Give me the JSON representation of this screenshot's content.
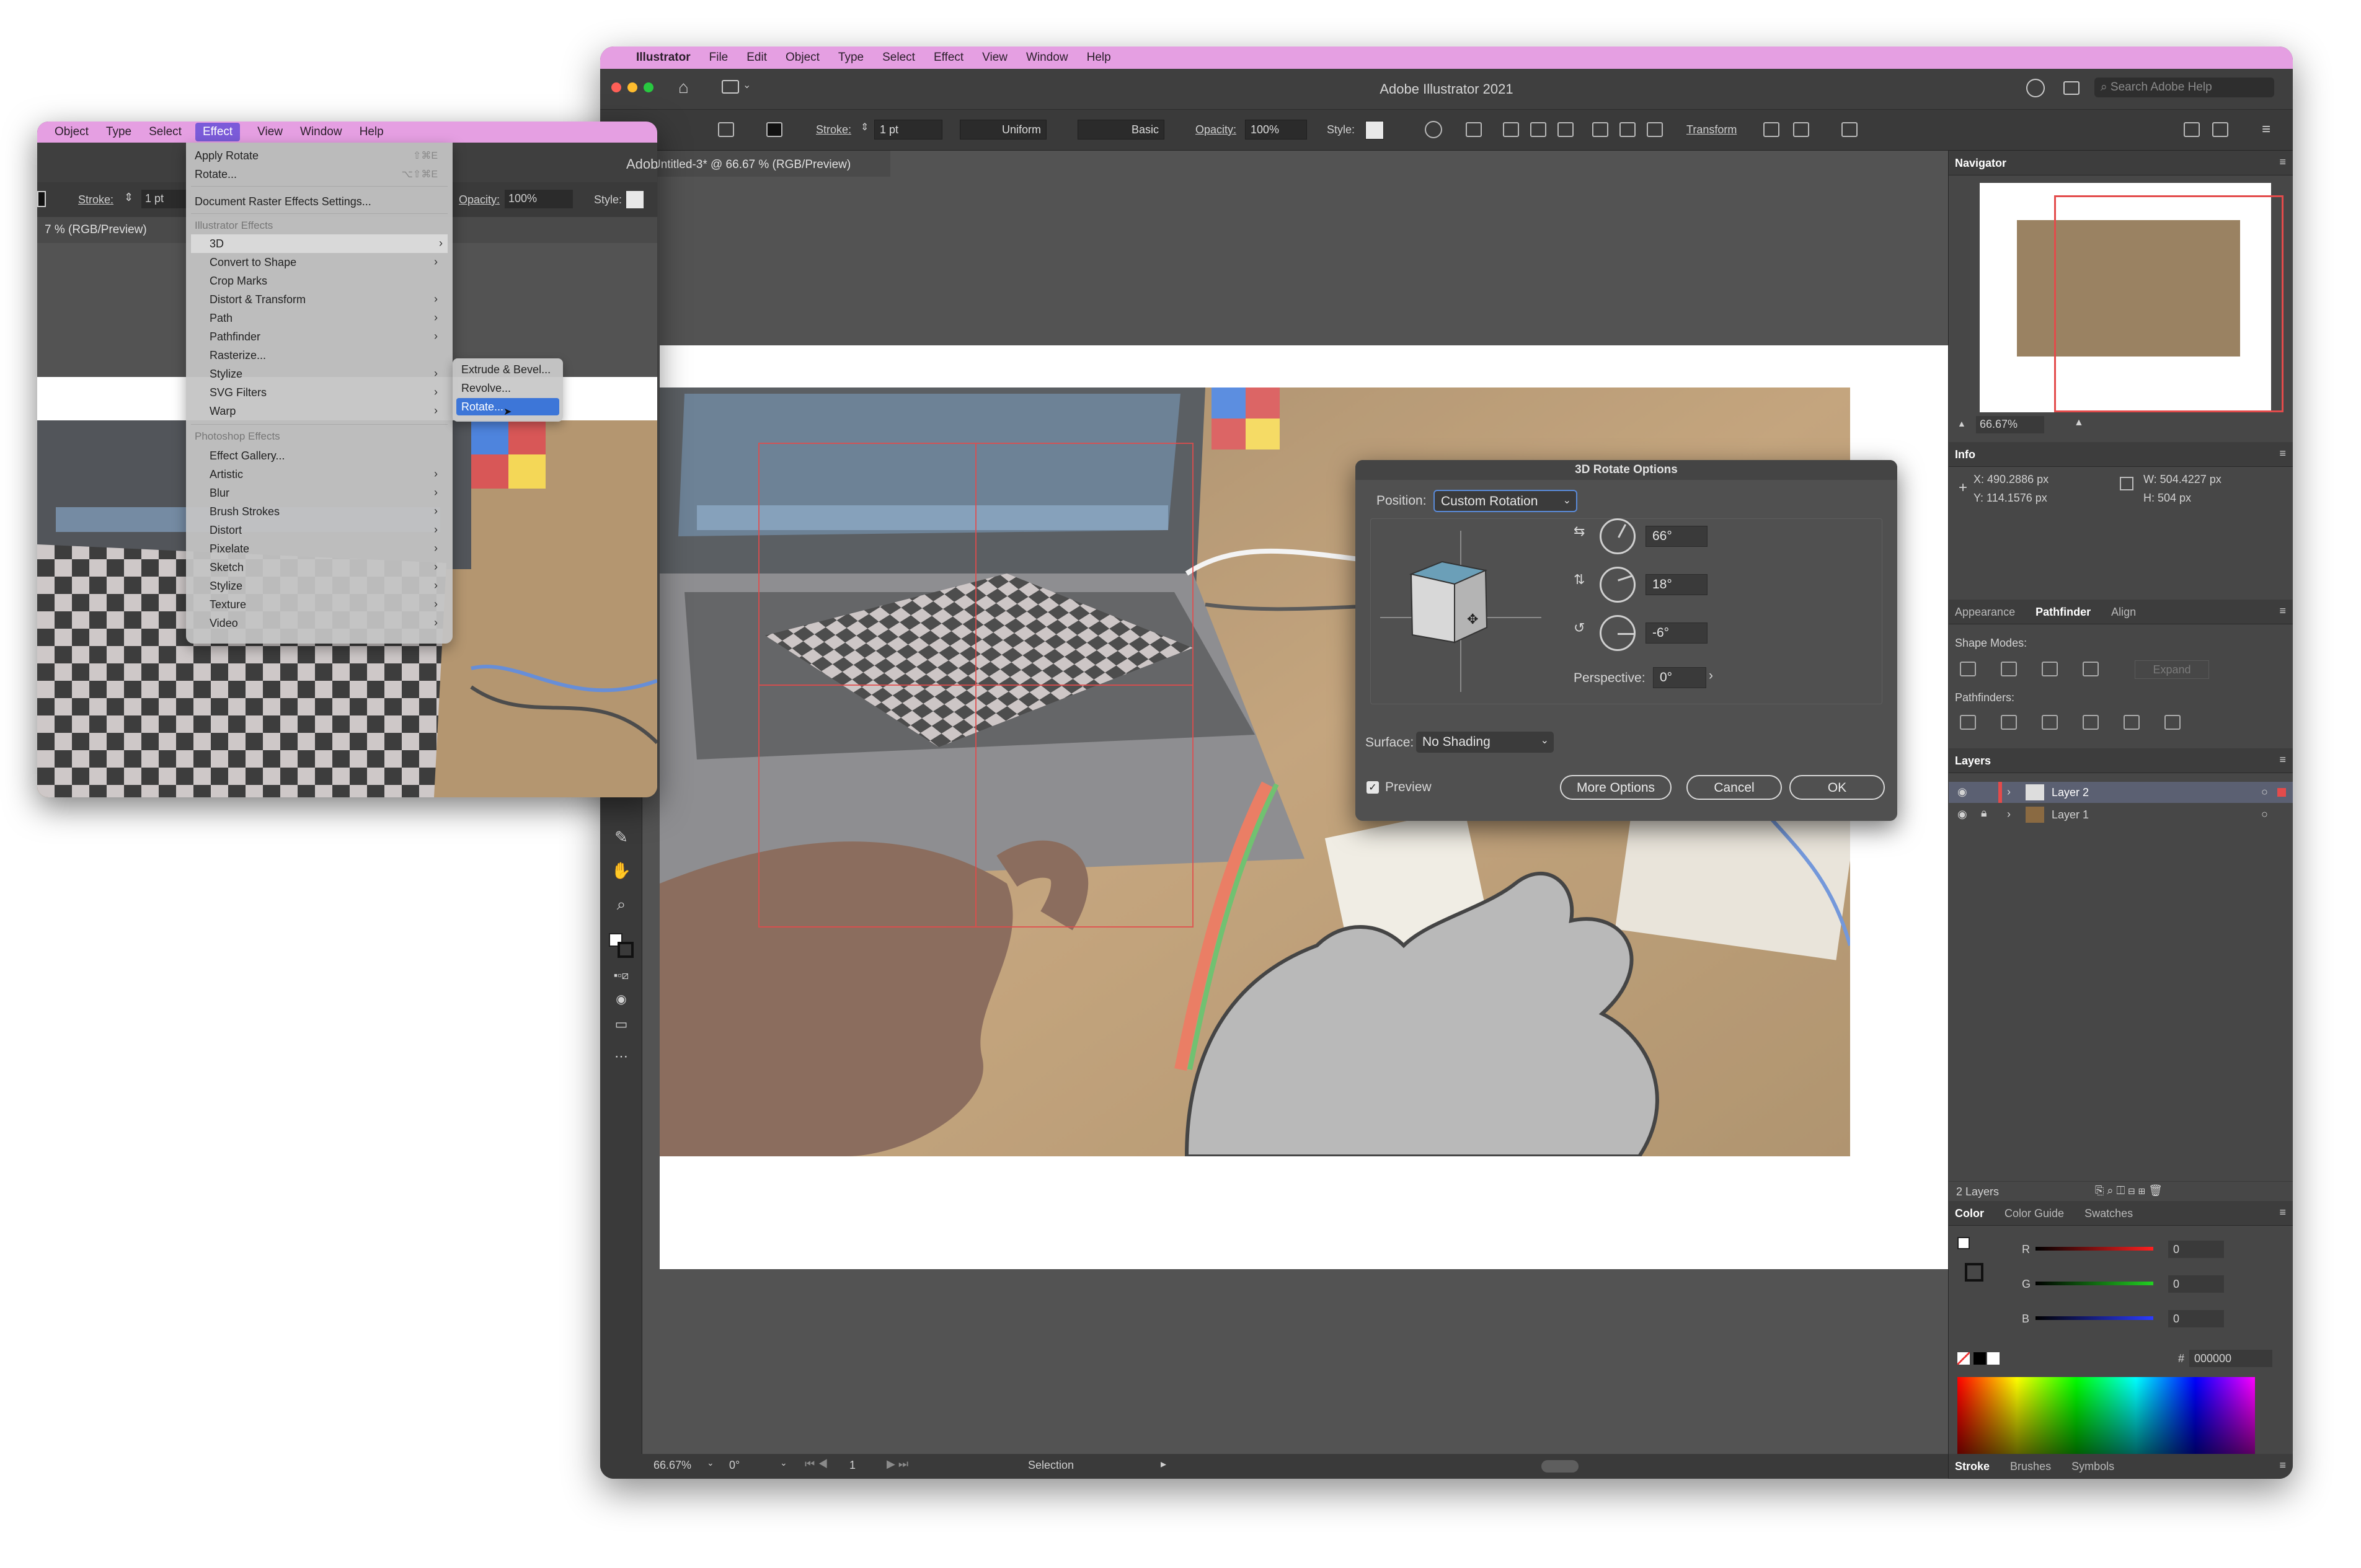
{
  "main": {
    "menubar": {
      "app_name": "Illustrator",
      "items": [
        "File",
        "Edit",
        "Object",
        "Type",
        "Select",
        "Effect",
        "View",
        "Window",
        "Help"
      ]
    },
    "window_title": "Adobe Illustrator 2021",
    "search_placeholder": "Search Adobe Help",
    "control_bar": {
      "stroke_label": "Stroke:",
      "stroke_value": "1 pt",
      "profile_value": "Uniform",
      "brush_value": "Basic",
      "opacity_label": "Opacity:",
      "opacity_value": "100%",
      "style_label": "Style:",
      "transform_label": "Transform"
    },
    "document_tab": "Untitled-3* @ 66.67 % (RGB/Preview)",
    "status_bar": {
      "zoom": "66.67%",
      "rotation": "0°",
      "artboard_number": "1",
      "tool_name": "Selection"
    }
  },
  "panels": {
    "navigator": {
      "title": "Navigator",
      "zoom": "66.67%"
    },
    "info": {
      "title": "Info",
      "x": "X: 490.2886 px",
      "y": "Y: 114.1576 px",
      "w": "W: 504.4227 px",
      "h": "H: 504 px"
    },
    "pathfinder_tabs": [
      "Appearance",
      "Pathfinder",
      "Align"
    ],
    "shape_modes_label": "Shape Modes:",
    "expand_label": "Expand",
    "pathfinders_label": "Pathfinders:",
    "layers": {
      "title": "Layers",
      "items": [
        {
          "name": "Layer 2",
          "color": "#e34b4b"
        },
        {
          "name": "Layer 1",
          "color": "#4b6be3"
        }
      ],
      "count": "2 Layers"
    },
    "color_tabs": [
      "Color",
      "Color Guide",
      "Swatches"
    ],
    "color": {
      "r_label": "R",
      "r_value": "0",
      "g_label": "G",
      "g_value": "0",
      "b_label": "B",
      "b_value": "0",
      "hex_label": "#",
      "hex_value": "000000"
    },
    "bottom_tabs": [
      "Stroke",
      "Brushes",
      "Symbols"
    ]
  },
  "dialog": {
    "title": "3D Rotate Options",
    "position_label": "Position:",
    "position_value": "Custom Rotation",
    "x_angle": "66°",
    "y_angle": "18°",
    "z_angle": "-6°",
    "perspective_label": "Perspective:",
    "perspective_value": "0°",
    "surface_label": "Surface:",
    "surface_value": "No Shading",
    "preview_label": "Preview",
    "more_options": "More Options",
    "cancel": "Cancel",
    "ok": "OK"
  },
  "inset": {
    "menubar": [
      "Object",
      "Type",
      "Select",
      "Effect",
      "View",
      "Window",
      "Help"
    ],
    "window_title_fragment": "Adob",
    "control": {
      "stroke_label": "Stroke:",
      "stroke_value": "1 pt",
      "opacity_label": "Opacity:",
      "opacity_value": "100%",
      "style_label": "Style:"
    },
    "tab_fragment": "7 % (RGB/Preview)",
    "effect_menu": {
      "apply_rotate": "Apply Rotate",
      "apply_shortcut": "⇧⌘E",
      "rotate": "Rotate...",
      "rotate_shortcut": "⌥⇧⌘E",
      "document_raster": "Document Raster Effects Settings...",
      "illustrator_header": "Illustrator Effects",
      "illustrator_items": [
        "3D",
        "Convert to Shape",
        "Crop Marks",
        "Distort & Transform",
        "Path",
        "Pathfinder",
        "Rasterize...",
        "Stylize",
        "SVG Filters",
        "Warp"
      ],
      "photoshop_header": "Photoshop Effects",
      "photoshop_items": [
        "Effect Gallery...",
        "Artistic",
        "Blur",
        "Brush Strokes",
        "Distort",
        "Pixelate",
        "Sketch",
        "Stylize",
        "Texture",
        "Video"
      ]
    },
    "submenu_3d": [
      "Extrude & Bevel...",
      "Revolve...",
      "Rotate..."
    ]
  }
}
